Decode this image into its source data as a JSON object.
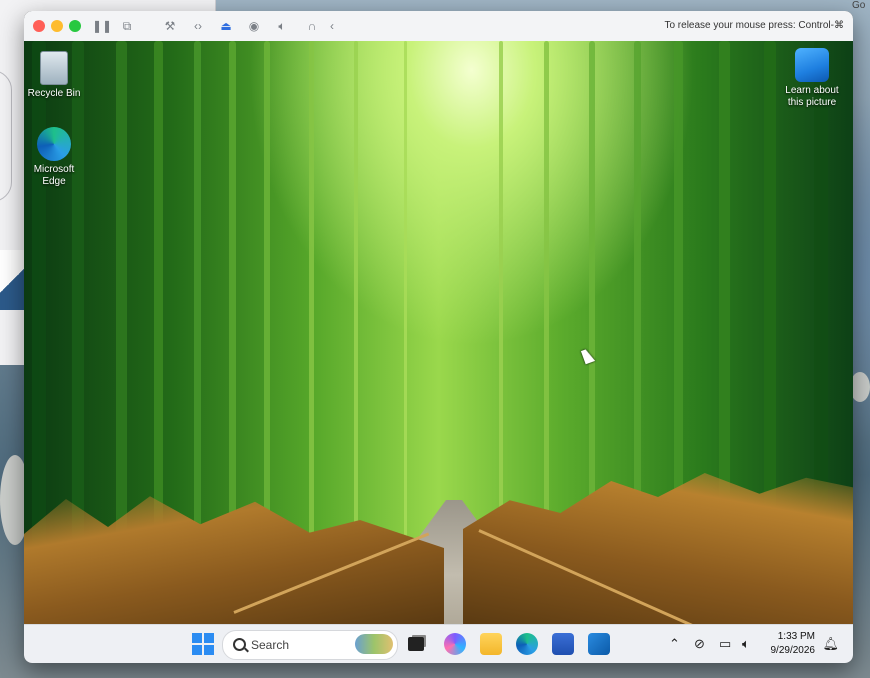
{
  "host": {
    "corner_text": "Go"
  },
  "vm_toolbar": {
    "release_hint": "To release your mouse press: Control-⌘",
    "icons": [
      "pause-icon",
      "snapshot-icon",
      "wrench-icon",
      "code-icon",
      "drive-icon",
      "camera-icon",
      "volume-icon",
      "headphones-icon",
      "back-chevron-icon"
    ]
  },
  "desktop": {
    "icons": [
      {
        "name": "recycle-bin",
        "label": "Recycle Bin"
      },
      {
        "name": "microsoft-edge",
        "label": "Microsoft Edge"
      },
      {
        "name": "learn-about-picture",
        "label": "Learn about this picture"
      }
    ]
  },
  "taskbar": {
    "search_placeholder": "Search",
    "apps": [
      "windows-start-icon",
      "task-view-icon",
      "copilot-icon",
      "file-explorer-icon",
      "edge-icon",
      "store-icon",
      "outlook-icon"
    ],
    "time": "1:33 PM",
    "date": "9/29/2026"
  },
  "colors": {
    "accent": "#2f6ee0",
    "close": "#ff5f57",
    "minimize": "#febc2e",
    "zoom": "#28c840"
  }
}
